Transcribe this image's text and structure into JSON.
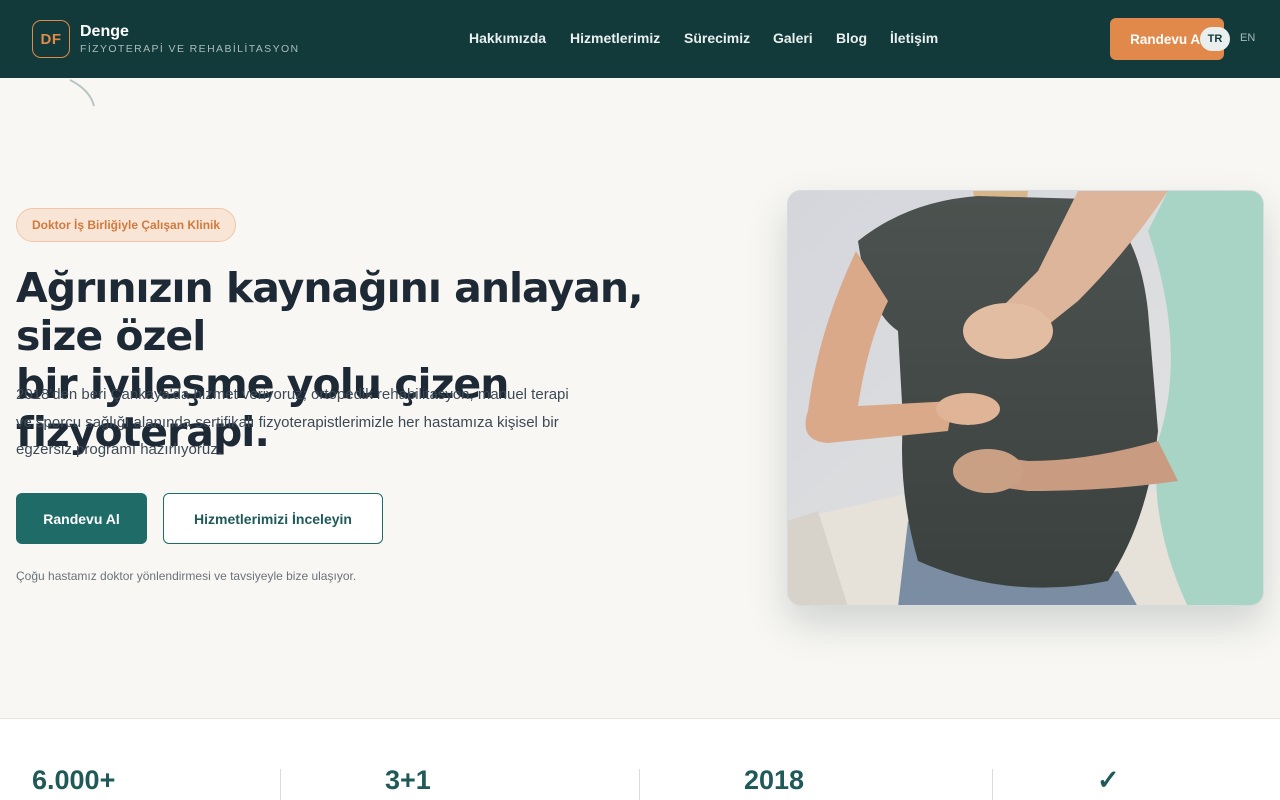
{
  "brand": {
    "monogram": "DF",
    "name": "Denge",
    "subtitle": "FİZYOTERAPİ VE REHABİLİTASYON"
  },
  "nav": {
    "items": [
      "Hakkımızda",
      "Hizmetlerimiz",
      "Sürecimiz",
      "Galeri",
      "Blog",
      "İletişim"
    ]
  },
  "header": {
    "cta_label": "Randevu Al",
    "languages": {
      "active": "TR",
      "other": "EN"
    }
  },
  "hero": {
    "badge": "Doktor İş Birliğiyle Çalışan Klinik",
    "title_line1": "Ağrınızın kaynağını anlayan, size özel",
    "title_line2": "bir iyileşme yolu çizen fizyoterapi.",
    "description": "2018'den beri Çankaya'da hizmet veriyoruz; ortopedik rehabilitasyon, manuel terapi ve sporcu sağlığı alanında sertifikalı fizyoterapistlerimizle her hastamıza kişisel bir egzersiz programı hazırlıyoruz.",
    "primary_button": "Randevu Al",
    "secondary_button": "Hizmetlerimizi İnceleyin",
    "note": "Çoğu hastamız doktor yönlendirmesi ve tavsiyeyle bize ulaşıyor."
  },
  "stats": [
    "6.000+",
    "3+1",
    "2018",
    "✓"
  ],
  "colors": {
    "header_bg": "#123a3a",
    "accent_orange": "#e0894b",
    "primary_teal": "#1f6b68",
    "page_bg": "#f8f7f4"
  }
}
